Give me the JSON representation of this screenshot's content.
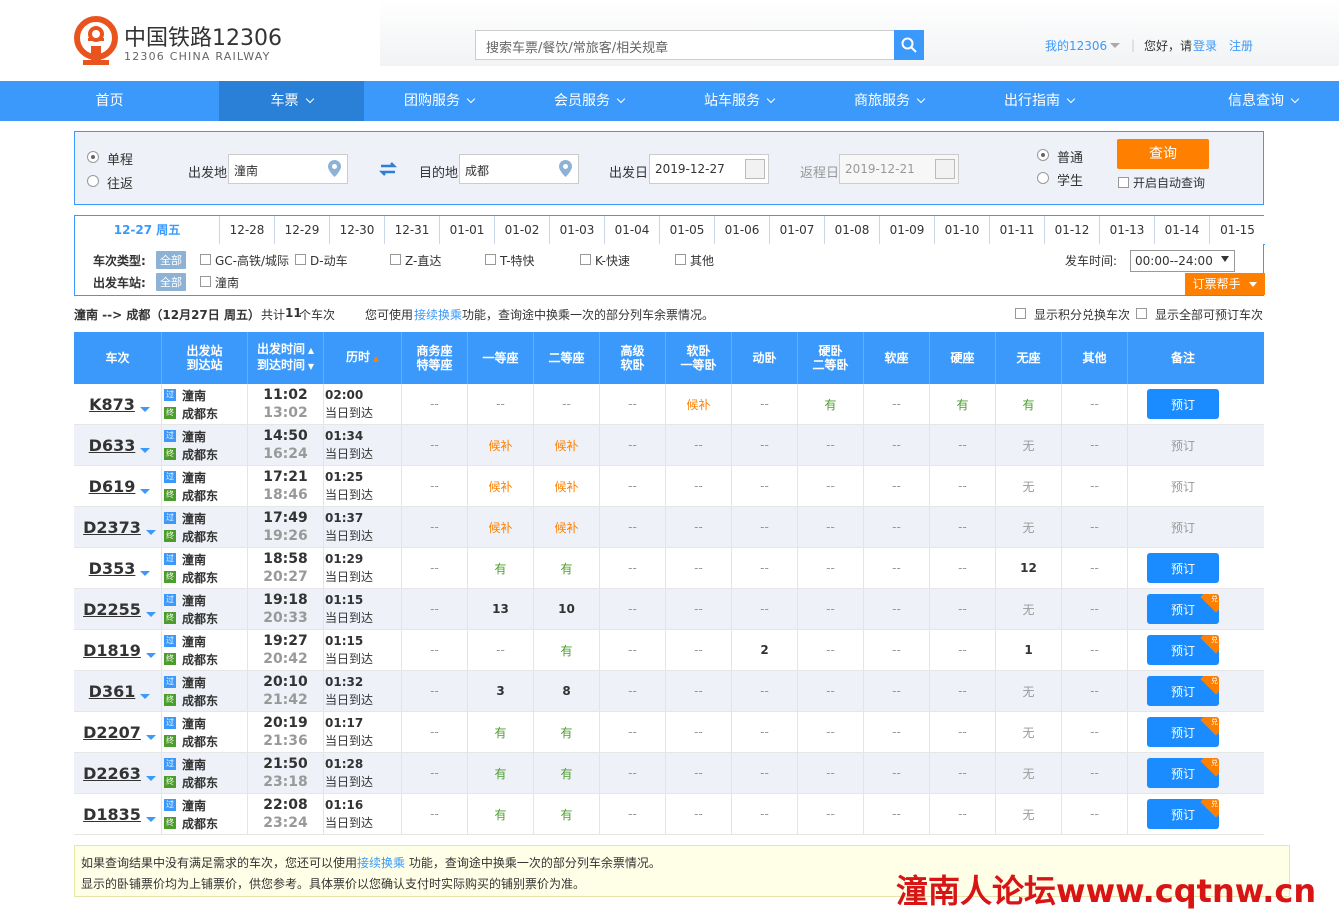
{
  "header": {
    "logo_text": "中国铁路12306",
    "logo_sub": "12306 CHINA RAILWAY",
    "search_placeholder": "搜索车票/餐饮/常旅客/相关规章",
    "my12306": "我的12306",
    "greeting": "您好，请",
    "login": "登录",
    "register": "注册",
    "sep": "|"
  },
  "nav": [
    {
      "label": "首页",
      "caret": false,
      "active": false
    },
    {
      "label": "车票",
      "caret": true,
      "active": true
    },
    {
      "label": "团购服务",
      "caret": true,
      "active": false
    },
    {
      "label": "会员服务",
      "caret": true,
      "active": false
    },
    {
      "label": "站车服务",
      "caret": true,
      "active": false
    },
    {
      "label": "商旅服务",
      "caret": true,
      "active": false
    },
    {
      "label": "出行指南",
      "caret": true,
      "active": false
    },
    {
      "label": "信息查询",
      "caret": true,
      "active": false
    }
  ],
  "query": {
    "oneway": "单程",
    "roundtrip": "往返",
    "from_label": "出发地",
    "from_value": "潼南",
    "to_label": "目的地",
    "to_value": "成都",
    "date_label": "出发日",
    "date_value": "2019-12-27",
    "return_label": "返程日",
    "return_value": "2019-12-21",
    "normal": "普通",
    "student": "学生",
    "query_button": "查询",
    "auto_query": "开启自动查询"
  },
  "dates": [
    "12-27 周五",
    "12-28",
    "12-29",
    "12-30",
    "12-31",
    "01-01",
    "01-02",
    "01-03",
    "01-04",
    "01-05",
    "01-06",
    "01-07",
    "01-08",
    "01-09",
    "01-10",
    "01-11",
    "01-12",
    "01-13",
    "01-14",
    "01-15"
  ],
  "filter": {
    "type_label": "车次类型:",
    "all": "全部",
    "types": [
      "GC-高铁/城际",
      "D-动车",
      "Z-直达",
      "T-特快",
      "K-快速",
      "其他"
    ],
    "station_label": "出发车站:",
    "stations": [
      "潼南"
    ],
    "time_label": "发车时间:",
    "time_value": "00:00--24:00",
    "helper": "订票帮手"
  },
  "summary": {
    "route": "潼南 --> 成都（12月27日  周五）",
    "count_prefix": "共计",
    "count": "11",
    "count_suffix": "个车次",
    "tip_pre": "您可使用",
    "tip_link": "接续换乘",
    "tip_post": "功能，查询途中换乘一次的部分列车余票情况。",
    "opt1": "显示积分兑换车次",
    "opt2": "显示全部可预订车次"
  },
  "columns": [
    "车次",
    "出发站\n到达站",
    "出发时间\n到达时间",
    "历时",
    "商务座\n特等座",
    "一等座",
    "二等座",
    "高级\n软卧",
    "软卧\n一等卧",
    "动卧",
    "硬卧\n二等卧",
    "软座",
    "硬座",
    "无座",
    "其他",
    "备注"
  ],
  "trains": [
    {
      "no": "K873",
      "from": "潼南",
      "to": "成都东",
      "dep": "11:02",
      "arr": "13:02",
      "dur": "02:00",
      "day": "当日到达",
      "seats": [
        "--",
        "--",
        "--",
        "--",
        "候补",
        "--",
        "有",
        "--",
        "有",
        "有",
        "--"
      ],
      "book": "预订",
      "bookable": true,
      "dui": false
    },
    {
      "no": "D633",
      "from": "潼南",
      "to": "成都东",
      "dep": "14:50",
      "arr": "16:24",
      "dur": "01:34",
      "day": "当日到达",
      "seats": [
        "--",
        "候补",
        "候补",
        "--",
        "--",
        "--",
        "--",
        "--",
        "--",
        "无",
        "--"
      ],
      "book": "预订",
      "bookable": false,
      "dui": false
    },
    {
      "no": "D619",
      "from": "潼南",
      "to": "成都东",
      "dep": "17:21",
      "arr": "18:46",
      "dur": "01:25",
      "day": "当日到达",
      "seats": [
        "--",
        "候补",
        "候补",
        "--",
        "--",
        "--",
        "--",
        "--",
        "--",
        "无",
        "--"
      ],
      "book": "预订",
      "bookable": false,
      "dui": false
    },
    {
      "no": "D2373",
      "from": "潼南",
      "to": "成都东",
      "dep": "17:49",
      "arr": "19:26",
      "dur": "01:37",
      "day": "当日到达",
      "seats": [
        "--",
        "候补",
        "候补",
        "--",
        "--",
        "--",
        "--",
        "--",
        "--",
        "无",
        "--"
      ],
      "book": "预订",
      "bookable": false,
      "dui": false
    },
    {
      "no": "D353",
      "from": "潼南",
      "to": "成都东",
      "dep": "18:58",
      "arr": "20:27",
      "dur": "01:29",
      "day": "当日到达",
      "seats": [
        "--",
        "有",
        "有",
        "--",
        "--",
        "--",
        "--",
        "--",
        "--",
        "12",
        "--"
      ],
      "book": "预订",
      "bookable": true,
      "dui": false
    },
    {
      "no": "D2255",
      "from": "潼南",
      "to": "成都东",
      "dep": "19:18",
      "arr": "20:33",
      "dur": "01:15",
      "day": "当日到达",
      "seats": [
        "--",
        "13",
        "10",
        "--",
        "--",
        "--",
        "--",
        "--",
        "--",
        "无",
        "--"
      ],
      "book": "预订",
      "bookable": true,
      "dui": true
    },
    {
      "no": "D1819",
      "from": "潼南",
      "to": "成都东",
      "dep": "19:27",
      "arr": "20:42",
      "dur": "01:15",
      "day": "当日到达",
      "seats": [
        "--",
        "--",
        "有",
        "--",
        "--",
        "2",
        "--",
        "--",
        "--",
        "1",
        "--"
      ],
      "book": "预订",
      "bookable": true,
      "dui": true
    },
    {
      "no": "D361",
      "from": "潼南",
      "to": "成都东",
      "dep": "20:10",
      "arr": "21:42",
      "dur": "01:32",
      "day": "当日到达",
      "seats": [
        "--",
        "3",
        "8",
        "--",
        "--",
        "--",
        "--",
        "--",
        "--",
        "无",
        "--"
      ],
      "book": "预订",
      "bookable": true,
      "dui": true
    },
    {
      "no": "D2207",
      "from": "潼南",
      "to": "成都东",
      "dep": "20:19",
      "arr": "21:36",
      "dur": "01:17",
      "day": "当日到达",
      "seats": [
        "--",
        "有",
        "有",
        "--",
        "--",
        "--",
        "--",
        "--",
        "--",
        "无",
        "--"
      ],
      "book": "预订",
      "bookable": true,
      "dui": true
    },
    {
      "no": "D2263",
      "from": "潼南",
      "to": "成都东",
      "dep": "21:50",
      "arr": "23:18",
      "dur": "01:28",
      "day": "当日到达",
      "seats": [
        "--",
        "有",
        "有",
        "--",
        "--",
        "--",
        "--",
        "--",
        "--",
        "无",
        "--"
      ],
      "book": "预订",
      "bookable": true,
      "dui": true
    },
    {
      "no": "D1835",
      "from": "潼南",
      "to": "成都东",
      "dep": "22:08",
      "arr": "23:24",
      "dur": "01:16",
      "day": "当日到达",
      "seats": [
        "--",
        "有",
        "有",
        "--",
        "--",
        "--",
        "--",
        "--",
        "--",
        "无",
        "--"
      ],
      "book": "预订",
      "bookable": true,
      "dui": true
    }
  ],
  "icons": {
    "pass": "过",
    "end": "终",
    "dui": "兑"
  },
  "notice": {
    "line1_pre": "如果查询结果中没有满足需求的车次，您还可以使用",
    "line1_link": "接续换乘",
    "line1_post": " 功能，查询途中换乘一次的部分列车余票情况。",
    "line2": "显示的卧铺票价均为上铺票价，供您参考。具体票价以您确认支付时实际购买的铺别票价为准。"
  },
  "watermark": "潼南人论坛www.cqtnw.cn",
  "colors": {
    "primary": "#3b99fc",
    "orange": "#ff8000",
    "green": "#4c9e2c",
    "logo_red": "#e9541e"
  }
}
